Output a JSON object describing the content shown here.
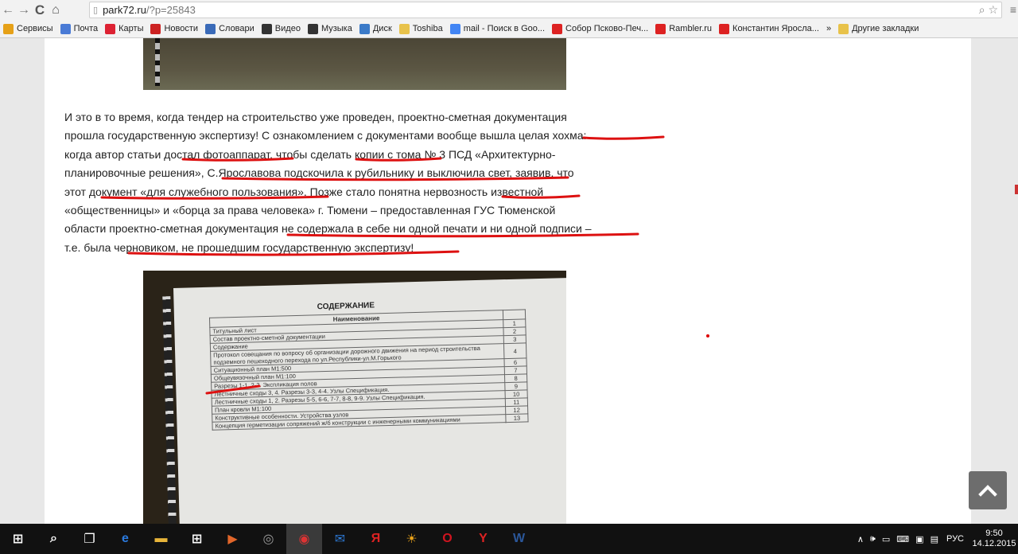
{
  "browser": {
    "url_domain": "park72.ru",
    "url_path": "/?p=25843"
  },
  "bookmarks": [
    {
      "label": "Сервисы",
      "icon": "apps-grid-icon",
      "color": "#e6a118"
    },
    {
      "label": "Почта",
      "icon": "mail-icon",
      "color": "#4a7bd6"
    },
    {
      "label": "Карты",
      "icon": "map-pin-icon",
      "color": "#d23"
    },
    {
      "label": "Новости",
      "icon": "news-icon",
      "color": "#c22"
    },
    {
      "label": "Словари",
      "icon": "dictionary-icon",
      "color": "#3a6ab8"
    },
    {
      "label": "Видео",
      "icon": "video-play-icon",
      "color": "#333"
    },
    {
      "label": "Музыка",
      "icon": "music-icon",
      "color": "#333"
    },
    {
      "label": "Диск",
      "icon": "disk-icon",
      "color": "#3a7ac8"
    },
    {
      "label": "Toshiba",
      "icon": "folder-icon",
      "color": "#e8c24a"
    },
    {
      "label": "mail - Поиск в Goo...",
      "icon": "google-icon",
      "color": "#4285f4"
    },
    {
      "label": "Собор Псково-Печ...",
      "icon": "yandex-icon",
      "color": "#d22"
    },
    {
      "label": "Rambler.ru",
      "icon": "yandex-icon",
      "color": "#d22"
    },
    {
      "label": "Константин Яросла...",
      "icon": "yandex-icon",
      "color": "#d22"
    },
    {
      "label": "»",
      "icon": "",
      "color": ""
    },
    {
      "label": "Другие закладки",
      "icon": "folder-icon",
      "color": "#e8c24a"
    }
  ],
  "article": {
    "lines": [
      "И это в то время, когда тендер на строительство уже проведен, проектно-сметная документация",
      "прошла государственную экспертизу! С ознакомлением с документами вообще вышла целая хохма:",
      "когда автор статьи достал фотоаппарат, чтобы сделать копии с тома № 3 ПСД «Архитектурно-",
      "планировочные решения», С.Ярославова подскочила к рубильнику и выключила свет, заявив, что",
      "этот документ «для служебного пользования». Позже стало понятна нервозность известной",
      "«общественницы» и «борца за права человека» г. Тюмени – предоставленная ГУС Тюменской",
      "области проектно-сметная документация не содержала в себе ни одной печати и ни одной подписи –",
      "т.е. была черновиком, не прошедшим государственную экспертизу!"
    ]
  },
  "document_photo": {
    "title": "СОДЕРЖАНИЕ",
    "column_header": "Наименование",
    "rows": [
      {
        "name": "Титульный лист",
        "num": "1"
      },
      {
        "name": "Состав проектно-сметной документации",
        "num": "2"
      },
      {
        "name": "Содержание",
        "num": "3"
      },
      {
        "name": "Протокол совещания по вопросу об организации дорожного движения на период строительства подземного пешеходного перехода по ул.Республики-ул.М.Горького",
        "num": "4"
      },
      {
        "name": "Ситуационный план М1:500",
        "num": "6"
      },
      {
        "name": "Общеувязочный план М1:100",
        "num": "7"
      },
      {
        "name": "Разрезы 1-1, 2-2. Экспликация полов",
        "num": "8"
      },
      {
        "name": "Лестничные сходы 3, 4. Разрезы 3-3, 4-4. Узлы Спецификация.",
        "num": "9"
      },
      {
        "name": "Лестничные сходы 1, 2. Разрезы 5-5, 6-6, 7-7, 8-8, 9-9. Узлы Спецификация.",
        "num": "10"
      },
      {
        "name": "План кровли М1:100",
        "num": "11"
      },
      {
        "name": "Конструктивные особенности. Устройства узлов",
        "num": "12"
      },
      {
        "name": "Концепция герметизации сопряжений ж/б конструкции с инженерными коммуникациями",
        "num": "13"
      }
    ]
  },
  "taskbar": {
    "apps": [
      {
        "name": "start-icon",
        "color": "#ffffff",
        "glyph": "⊞"
      },
      {
        "name": "search-icon",
        "color": "#ffffff",
        "glyph": "⌕"
      },
      {
        "name": "task-view-icon",
        "color": "#ffffff",
        "glyph": "❐"
      },
      {
        "name": "edge-icon",
        "color": "#2b7be0",
        "glyph": "e"
      },
      {
        "name": "file-explorer-icon",
        "color": "#e8b53a",
        "glyph": "▬"
      },
      {
        "name": "store-icon",
        "color": "#ffffff",
        "glyph": "⊞"
      },
      {
        "name": "media-player-icon",
        "color": "#e2662a",
        "glyph": "▶"
      },
      {
        "name": "disc-icon",
        "color": "#9a9a9a",
        "glyph": "◎"
      },
      {
        "name": "chrome-icon",
        "color": "#d33",
        "glyph": "◉"
      },
      {
        "name": "mail-app-icon",
        "color": "#2d77d0",
        "glyph": "✉"
      },
      {
        "name": "yandex-app-icon",
        "color": "#d22",
        "glyph": "Я"
      },
      {
        "name": "sun-app-icon",
        "color": "#e9a21a",
        "glyph": "☀"
      },
      {
        "name": "opera-icon",
        "color": "#d1141f",
        "glyph": "O"
      },
      {
        "name": "yandex-browser-icon",
        "color": "#d22",
        "glyph": "Y"
      },
      {
        "name": "word-icon",
        "color": "#2b579a",
        "glyph": "W"
      }
    ],
    "language": "РУС",
    "time": "9:50",
    "date": "14.12.2015"
  }
}
